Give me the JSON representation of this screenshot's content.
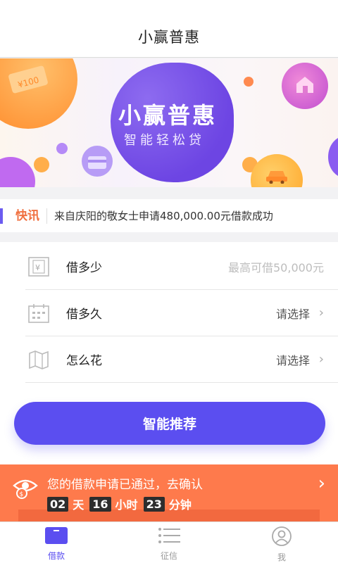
{
  "header": {
    "title": "小赢普惠"
  },
  "banner": {
    "title": "小赢普惠",
    "subtitle": "智能轻松贷",
    "coupon_text": "¥100"
  },
  "news": {
    "tag": "快讯",
    "message": "来自庆阳的敬女士申请480,000.00元借款成功"
  },
  "form": {
    "rows": [
      {
        "label": "借多少",
        "value": "最高可借50,000元",
        "icon": "yuan-icon"
      },
      {
        "label": "借多久",
        "value": "请选择",
        "icon": "calendar-icon"
      },
      {
        "label": "怎么花",
        "value": "请选择",
        "icon": "map-icon"
      }
    ],
    "submit_label": "智能推荐"
  },
  "notice": {
    "message": "您的借款申请已通过，去确认",
    "days": "02",
    "days_unit": "天",
    "hours": "16",
    "hours_unit": "小时",
    "minutes": "23",
    "minutes_unit": "分钟"
  },
  "tabs": [
    {
      "label": "借款",
      "icon": "loan-card-icon",
      "active": true
    },
    {
      "label": "征信",
      "icon": "list-icon",
      "active": false
    },
    {
      "label": "我",
      "icon": "user-icon",
      "active": false
    }
  ],
  "colors": {
    "accent": "#5b4ef0",
    "notice": "#fe7a4c",
    "news_tag": "#f07040"
  }
}
